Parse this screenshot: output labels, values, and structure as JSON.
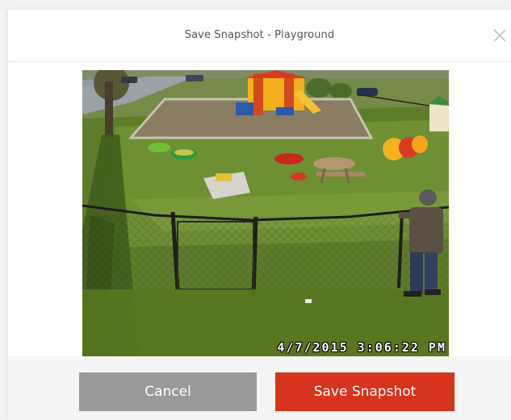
{
  "dialog": {
    "title": "Save Snapshot - Playground"
  },
  "snapshot": {
    "timestamp": "4/7/2015 3:06:22 PM"
  },
  "footer": {
    "cancel_label": "Cancel",
    "save_label": "Save Snapshot"
  },
  "colors": {
    "save_button": "#d6341c",
    "cancel_button": "#999999"
  }
}
